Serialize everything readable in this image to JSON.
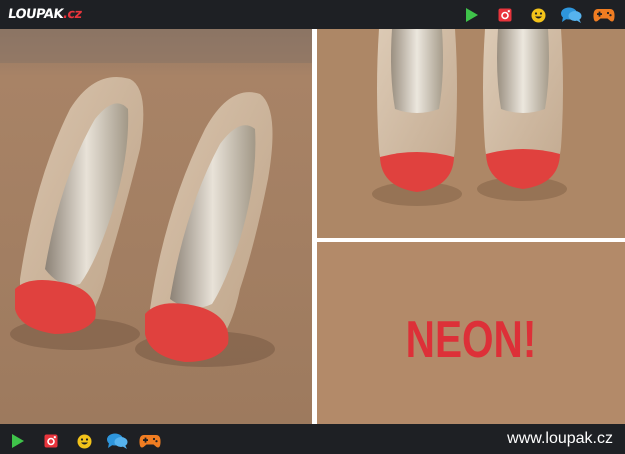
{
  "header": {
    "logo_text": "LOUPAK",
    "logo_tld": ".cz"
  },
  "nav_icons": [
    "play-icon",
    "instagram-icon",
    "smiley-icon",
    "chat-icon",
    "gamepad-icon"
  ],
  "icon_colors": {
    "play": "#3fc34a",
    "instagram": "#e8343c",
    "smiley": "#f3c31a",
    "chat": "#2e96dc",
    "gamepad": "#f07d22"
  },
  "panels": {
    "left": "close-up photo of beige patent heels with coral toe caps",
    "right_top": "photo of heels from front",
    "right_bottom": {
      "caption": "NEON!"
    }
  },
  "footer": {
    "url": "www.loupak.cz"
  }
}
